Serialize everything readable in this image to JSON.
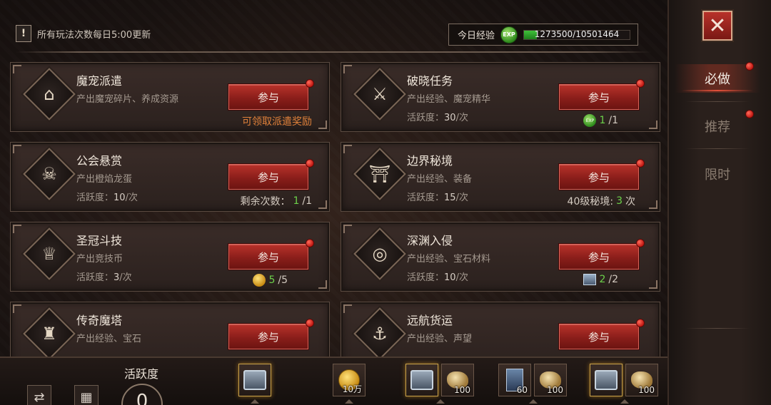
{
  "notice": {
    "icon": "exclamation-icon",
    "text": "所有玩法次数每日5:00更新"
  },
  "exp": {
    "label": "今日经验",
    "orb": "EXP",
    "current": 1273500,
    "max": 10501464,
    "text": "1273500/10501464",
    "fill_ratio": 0.121
  },
  "cards": [
    {
      "title": "魔宠派遣",
      "desc": "产出魔宠碎片、养成资源",
      "active_label": "",
      "active_value": "",
      "active_suffix": "",
      "button": "参与",
      "note": "可领取派遣奖励",
      "note_type": "orange",
      "icon": "pet-dispatch-icon"
    },
    {
      "title": "破晓任务",
      "desc": "产出经验、魔宠精华",
      "active_label": "活跃度：",
      "active_value": "30",
      "active_suffix": "/次",
      "button": "参与",
      "note_icon": "EXP",
      "note_current": "1",
      "note_total": "/1",
      "icon": "scroll-sword-icon"
    },
    {
      "title": "公会悬赏",
      "desc": "产出橙焰龙蛋",
      "active_label": "活跃度：",
      "active_value": "10",
      "active_suffix": "/次",
      "button": "参与",
      "note_prefix": "剩余次数：",
      "note_current": "1",
      "note_total": "/1",
      "icon": "pirate-hat-icon"
    },
    {
      "title": "边界秘境",
      "desc": "产出经验、装备",
      "active_label": "活跃度：",
      "active_value": "15",
      "active_suffix": "/次",
      "button": "参与",
      "note_prefix": "40级秘境:",
      "note_current": "3",
      "note_total": "次",
      "icon": "gate-icon"
    },
    {
      "title": "圣冠斗技",
      "desc": "产出竞技币",
      "active_label": "活跃度：",
      "active_value": "3",
      "active_suffix": "/次",
      "button": "参与",
      "note_current": "5",
      "note_total": "/5",
      "icon": "trophy-icon"
    },
    {
      "title": "深渊入侵",
      "desc": "产出经验、宝石材料",
      "active_label": "活跃度：",
      "active_value": "10",
      "active_suffix": "/次",
      "button": "参与",
      "note_current": "2",
      "note_total": "/2",
      "icon": "abyss-gate-icon"
    },
    {
      "title": "传奇魔塔",
      "desc": "产出经验、宝石",
      "active_label": "",
      "active_value": "",
      "active_suffix": "",
      "button": "参与",
      "icon": "tower-icon"
    },
    {
      "title": "远航货运",
      "desc": "产出经验、声望",
      "active_label": "",
      "active_value": "",
      "active_suffix": "",
      "button": "参与",
      "icon": "anchor-icon"
    }
  ],
  "bottom": {
    "activity_label": "活跃度",
    "activity_value": "0",
    "rewards": [
      {
        "type": "chest",
        "amount": ""
      },
      {
        "type": "coin",
        "amount": "10万"
      },
      {
        "type": "chest",
        "amount": ""
      },
      {
        "type": "ore",
        "amount": "100"
      },
      {
        "type": "card",
        "amount": "60"
      },
      {
        "type": "ore",
        "amount": "100"
      },
      {
        "type": "chest",
        "amount": ""
      },
      {
        "type": "ore",
        "amount": "100"
      }
    ]
  },
  "sidebar": {
    "close": "✕",
    "tabs": [
      {
        "label": "必做",
        "active": true
      },
      {
        "label": "推荐",
        "active": false
      },
      {
        "label": "限时",
        "active": false
      }
    ]
  }
}
